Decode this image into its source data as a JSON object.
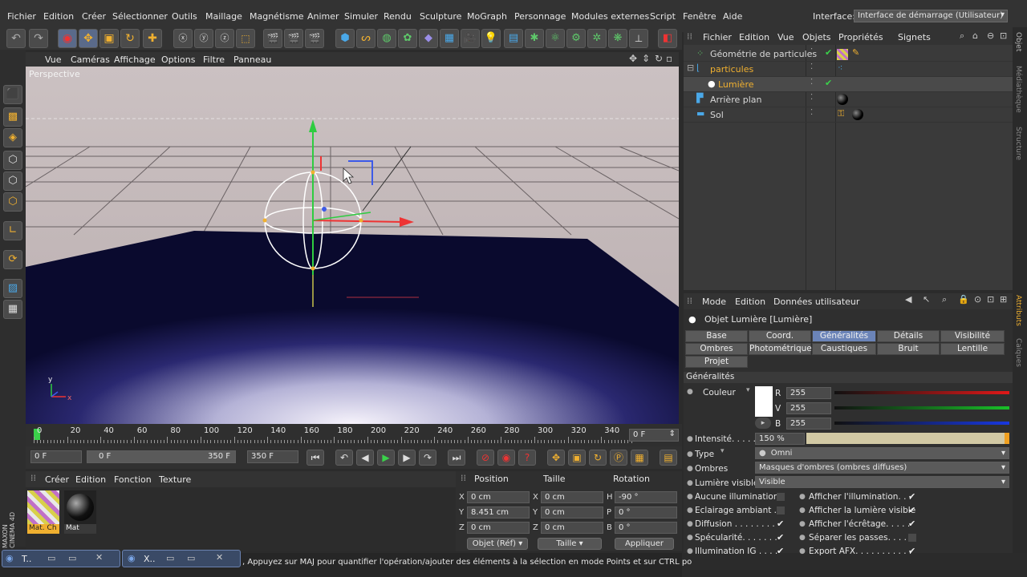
{
  "menubar": {
    "items": [
      "Fichier",
      "Edition",
      "Créer",
      "Sélectionner",
      "Outils",
      "Maillage",
      "Magnétisme",
      "Animer",
      "Simuler",
      "Rendu",
      "Sculpture",
      "MoGraph",
      "Personnage",
      "Modules externes",
      "Script",
      "Fenêtre",
      "Aide"
    ],
    "interface_label": "Interface:",
    "interface_value": "Interface de démarrage (Utilisateur)"
  },
  "viewport": {
    "menu": [
      "Vue",
      "Caméras",
      "Affichage",
      "Options",
      "Filtre",
      "Panneau"
    ],
    "label": "Perspective",
    "axis_x": "x",
    "axis_y": "y"
  },
  "timeline": {
    "ticks": [
      "0",
      "20",
      "40",
      "60",
      "80",
      "100",
      "120",
      "140",
      "160",
      "180",
      "200",
      "220",
      "240",
      "260",
      "280",
      "300",
      "320",
      "340"
    ],
    "current_frame": "0 F",
    "start_field": "0 F",
    "range_start": "0 F",
    "range_end": "350 F",
    "end_field": "350 F"
  },
  "materials": {
    "menu": [
      "Créer",
      "Edition",
      "Fonction",
      "Texture"
    ],
    "items": [
      {
        "label": "Mat. Ch"
      },
      {
        "label": "Mat"
      }
    ]
  },
  "coords": {
    "headers": {
      "position": "Position",
      "size": "Taille",
      "rotation": "Rotation"
    },
    "rows": [
      {
        "axis": "X",
        "pos": "0 cm",
        "size_axis": "X",
        "size": "0 cm",
        "rot_axis": "H",
        "rot": "-90 °"
      },
      {
        "axis": "Y",
        "pos": "8.451 cm",
        "size_axis": "Y",
        "size": "0 cm",
        "rot_axis": "P",
        "rot": "0 °"
      },
      {
        "axis": "Z",
        "pos": "0 cm",
        "size_axis": "Z",
        "size": "0 cm",
        "rot_axis": "B",
        "rot": "0 °"
      }
    ],
    "mode_select": "Objet (Réf)",
    "size_select": "Taille",
    "apply": "Appliquer"
  },
  "statusbar": {
    "text": ", Appuyez sur MAJ pour quantifier l'opération/ajouter des éléments à la sélection en mode Points et sur CTRL po",
    "tasks": [
      "T..",
      "X.."
    ]
  },
  "brand": "MAXON CINEMA 4D",
  "object_manager": {
    "menu": [
      "Fichier",
      "Edition",
      "Vue",
      "Objets",
      "Propriétés",
      "Signets"
    ],
    "objects": [
      {
        "name": "Géométrie de particules",
        "color": "#e8e8e8"
      },
      {
        "name": "particules",
        "color": "#f0b030"
      },
      {
        "name": "Lumière",
        "color": "#f0b030"
      },
      {
        "name": "Arrière plan",
        "color": "#e8e8e8"
      },
      {
        "name": "Sol",
        "color": "#e8e8e8"
      }
    ]
  },
  "attributes": {
    "menu": [
      "Mode",
      "Edition",
      "Données utilisateur"
    ],
    "title": "Objet Lumière [Lumière]",
    "tabs": [
      "Base",
      "Coord.",
      "Généralités",
      "Détails",
      "Visibilité",
      "Ombres",
      "Photométrique",
      "Caustiques",
      "Bruit",
      "Lentille",
      "Projet"
    ],
    "active_tab": "Généralités",
    "section": "Généralités",
    "color_label": "Couleur",
    "r_label": "R",
    "r": "255",
    "v_label": "V",
    "v": "255",
    "b_label": "B",
    "b": "255",
    "intensity_label": "Intensité. . . . .",
    "intensity": "150 %",
    "intensity_fraction": 1.0,
    "type_label": "Type",
    "type": "Omni",
    "shadows_label": "Ombres",
    "shadows": "Masques d'ombres (ombres diffuses)",
    "visible_label": "Lumière visible",
    "visible": "Visible",
    "options_left": [
      {
        "label": "Aucune illumination",
        "checked": false
      },
      {
        "label": "Eclairage ambiant . .",
        "checked": false
      },
      {
        "label": "Diffusion . . . . . . . .",
        "checked": true
      },
      {
        "label": "Spécularité. . . . . . .",
        "checked": true
      },
      {
        "label": "Illumination IG . . . .",
        "checked": true
      }
    ],
    "options_right": [
      {
        "label": "Afficher l'illumination. . .",
        "checked": true
      },
      {
        "label": "Afficher la lumière visible",
        "checked": true
      },
      {
        "label": "Afficher l'écrêtage. . . . .",
        "checked": true
      },
      {
        "label": "Séparer les passes. . . . .",
        "checked": false
      },
      {
        "label": "Export AFX. . . . . . . . . . .",
        "checked": true
      }
    ]
  },
  "right_strip": [
    "Objet",
    "Médiathèque",
    "Structure",
    "Attributs",
    "Calques"
  ],
  "colors": {
    "accent": "#6b84b8",
    "highlight": "#f0b030"
  }
}
